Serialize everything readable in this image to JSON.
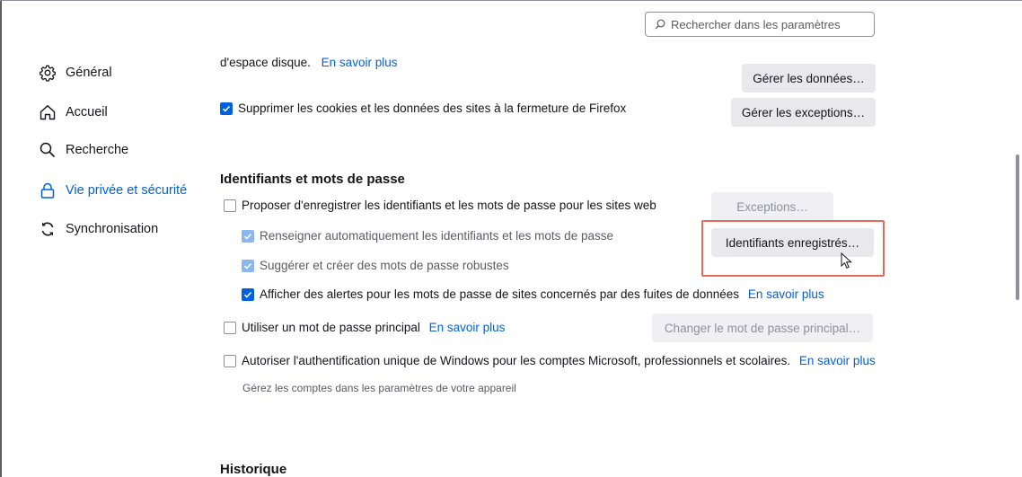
{
  "search": {
    "placeholder": "Rechercher dans les paramètres"
  },
  "sidebar": {
    "items": [
      {
        "label": "Général",
        "icon": "gear-icon"
      },
      {
        "label": "Accueil",
        "icon": "home-icon"
      },
      {
        "label": "Recherche",
        "icon": "search-icon"
      },
      {
        "label": "Vie privée et sécurité",
        "icon": "lock-icon",
        "active": true
      },
      {
        "label": "Synchronisation",
        "icon": "sync-icon"
      }
    ]
  },
  "cookies": {
    "disk_text": "d'espace disque.",
    "learn_more": "En savoir plus",
    "manage_data_button": "Gérer les données…",
    "delete_on_close_label": "Supprimer les cookies et les données des sites à la fermeture de Firefox",
    "delete_on_close_checked": true,
    "manage_exceptions_button": "Gérer les exceptions…"
  },
  "logins": {
    "heading": "Identifiants et mots de passe",
    "ask_to_save_label": "Proposer d'enregistrer les identifiants et les mots de passe pour les sites web",
    "ask_to_save_checked": false,
    "exceptions_button": "Exceptions…",
    "autofill_label": "Renseigner automatiquement les identifiants et les mots de passe",
    "autofill_checked": true,
    "saved_logins_button": "Identifiants enregistrés…",
    "suggest_label": "Suggérer et créer des mots de passe robustes",
    "suggest_checked": true,
    "breach_alerts_label": "Afficher des alertes pour les mots de passe de sites concernés par des fuites de données",
    "breach_alerts_checked": true,
    "breach_learn_more": "En savoir plus",
    "primary_password_label": "Utiliser un mot de passe principal",
    "primary_password_checked": false,
    "primary_learn_more": "En savoir plus",
    "change_primary_button": "Changer le mot de passe principal…",
    "windows_sso_label": "Autoriser l'authentification unique de Windows pour les comptes Microsoft, professionnels et scolaires.",
    "windows_sso_checked": false,
    "windows_learn_more": "En savoir plus",
    "windows_sso_hint": "Gérez les comptes dans les paramètres de votre appareil"
  },
  "history": {
    "heading": "Historique"
  },
  "colors": {
    "accent": "#0061e0",
    "highlight": "#e26b5a"
  }
}
